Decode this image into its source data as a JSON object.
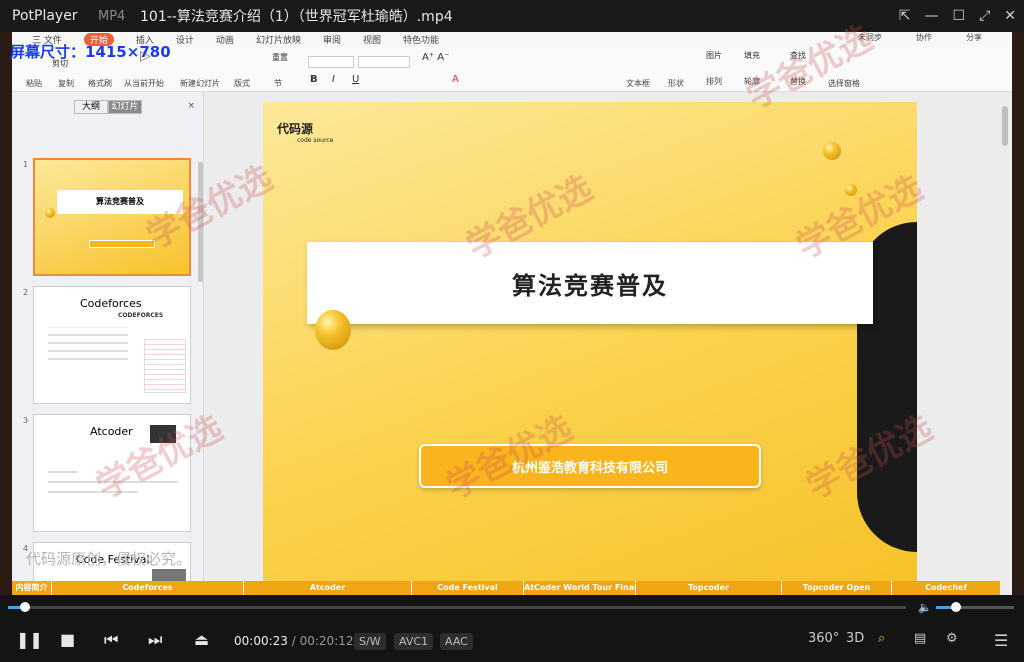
{
  "titlebar": {
    "app": "PotPlayer",
    "format": "MP4",
    "title": "101--算法竞赛介绍（1）（世界冠军杜瑜皓）.mp4"
  },
  "overlay": {
    "screen_size": "屏幕尺寸：1415×780"
  },
  "wps": {
    "menu": {
      "file": "三 文件",
      "tabs": [
        "开始",
        "插入",
        "设计",
        "动画",
        "幻灯片放映",
        "审阅",
        "视图",
        "特色功能"
      ],
      "right": [
        "未同步",
        "协作",
        "分享"
      ]
    },
    "ribbon": {
      "paste": "粘贴",
      "cut": "剪切",
      "copy": "复制",
      "format": "格式刷",
      "play": "从当前开始",
      "new_slide": "新建幻灯片",
      "layout": "版式",
      "reset": "重置",
      "section": "节",
      "textbox": "文本框",
      "shape": "形状",
      "picture": "图片",
      "fill": "填充",
      "arrange": "排列",
      "outline": "轮廓",
      "find": "查找",
      "replace": "替换",
      "select": "选择窗格"
    },
    "panel": {
      "tab_outline": "大纲",
      "tab_slides": "幻灯片",
      "close": "×",
      "slides": [
        {
          "num": "1",
          "title": "算法竞赛普及"
        },
        {
          "num": "2",
          "title": "Codeforces",
          "brand": "CODEFORCES"
        },
        {
          "num": "3",
          "title": "Atcoder"
        },
        {
          "num": "4",
          "title": "Code Festival"
        }
      ]
    },
    "slide": {
      "brand": "代码源",
      "brand_sub": "code source",
      "title": "算法竞赛普及",
      "company": "杭州鉴浩教育科技有限公司"
    }
  },
  "caption": "代码源原创，侵权必究。",
  "chapters": [
    "内容简介",
    "Codeforces",
    "Atcoder",
    "Code Festival",
    "AtCoder World Tour Final",
    "Topcoder",
    "Topcoder Open",
    "Codechef"
  ],
  "player": {
    "current": "00:00:23",
    "sep": "/",
    "duration": "00:20:12",
    "tags": [
      "S/W",
      "AVC1",
      "AAC"
    ],
    "progress": 0.019,
    "volume": 0.25
  },
  "watermark": "学爸优选"
}
